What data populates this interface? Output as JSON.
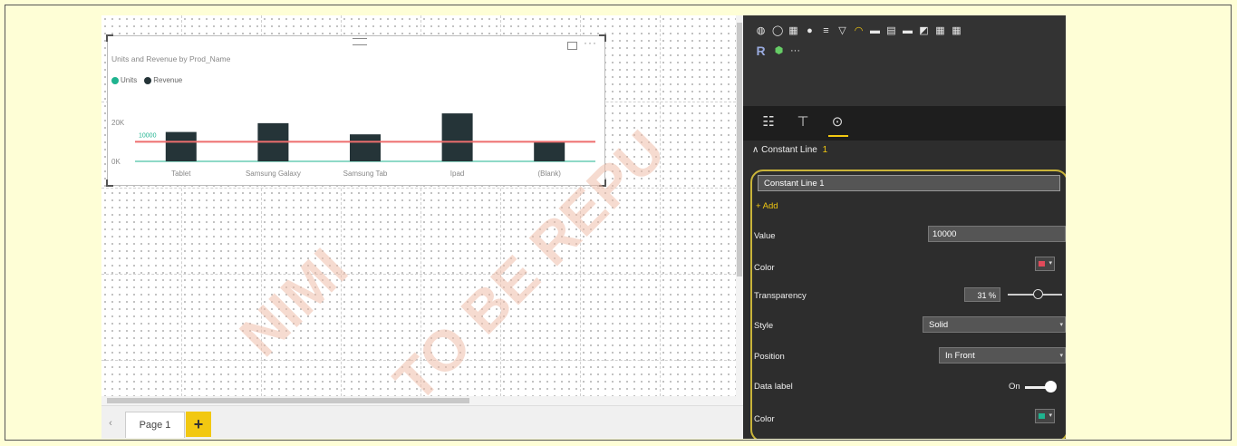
{
  "canvas": {
    "visual": {
      "title": "Units and Revenue by Prod_Name",
      "legend": [
        {
          "label": "Units",
          "color": "#1fb38f"
        },
        {
          "label": "Revenue",
          "color": "#253438"
        }
      ],
      "constant_line_label": "10000"
    }
  },
  "chart_data": {
    "type": "bar",
    "title": "Units and Revenue by Prod_Name",
    "categories": [
      "Tablet",
      "Samsung Galaxy",
      "Samsung Tab",
      "Ipad",
      "(Blank)"
    ],
    "series": [
      {
        "name": "Units",
        "values": [
          0,
          0,
          0,
          0,
          0
        ],
        "color": "#1fb38f"
      },
      {
        "name": "Revenue",
        "values": [
          15000,
          19500,
          13800,
          24500,
          10000
        ],
        "color": "#253438"
      }
    ],
    "y_ticks": [
      "20K",
      "0K"
    ],
    "ylim": [
      0,
      25000
    ],
    "constant_line": {
      "value": 10000,
      "color": "#ee6e6e",
      "label": "10000"
    }
  },
  "page_tabs": {
    "page_label": "Page 1",
    "add_label": "+"
  },
  "panel": {
    "viz_row3_extra": "R",
    "more_label": "···",
    "section_title": "Constant Line",
    "section_count": "1",
    "line_name": "Constant Line 1",
    "add_label": "+ Add",
    "value_label": "Value",
    "value": "10000",
    "color_label": "Color",
    "line_color": "#e04a5a",
    "transparency_label": "Transparency",
    "transparency_value": "31",
    "transparency_unit": "%",
    "style_label": "Style",
    "style_value": "Solid",
    "position_label": "Position",
    "position_value": "In Front",
    "data_label_label": "Data label",
    "data_label_state": "On",
    "color2_label": "Color",
    "label_color": "#1fb38f"
  }
}
